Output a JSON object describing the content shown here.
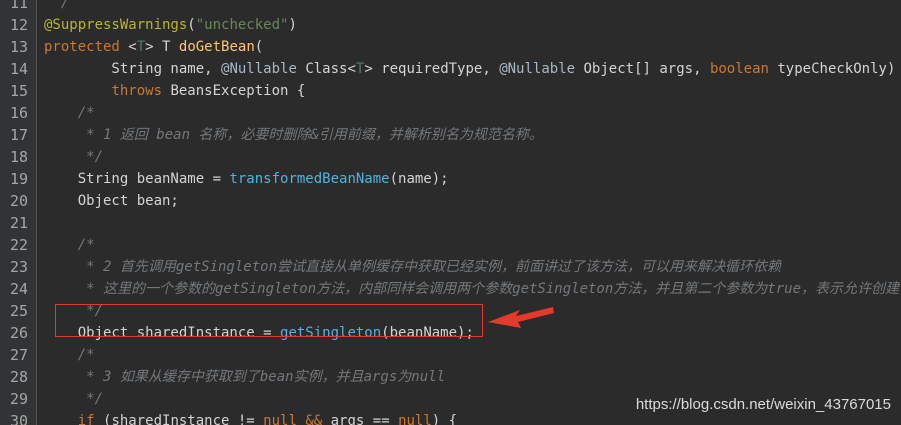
{
  "editor": {
    "lines": [
      {
        "num": "11",
        "tokens": [
          {
            "t": "  /",
            "c": "cm"
          }
        ]
      },
      {
        "num": "12",
        "tokens": [
          {
            "t": "@SuppressWarnings",
            "c": "ann"
          },
          {
            "t": "(",
            "c": "op"
          },
          {
            "t": "\"unchecked\"",
            "c": "str"
          },
          {
            "t": ")",
            "c": "op"
          }
        ]
      },
      {
        "num": "13",
        "tokens": [
          {
            "t": "protected ",
            "c": "kw"
          },
          {
            "t": "<",
            "c": "op"
          },
          {
            "t": "T",
            "c": "gen"
          },
          {
            "t": "> T ",
            "c": "op"
          },
          {
            "t": "doGetBean",
            "c": "fn"
          },
          {
            "t": "(",
            "c": "op"
          }
        ]
      },
      {
        "num": "14",
        "tokens": [
          {
            "t": "        String name, ",
            "c": "ty"
          },
          {
            "t": "@Nullable ",
            "c": "annp"
          },
          {
            "t": "Class",
            "c": "ty"
          },
          {
            "t": "<",
            "c": "op"
          },
          {
            "t": "T",
            "c": "gen"
          },
          {
            "t": "> requiredType, ",
            "c": "ty"
          },
          {
            "t": "@Nullable ",
            "c": "annp"
          },
          {
            "t": "Object[] args, ",
            "c": "ty"
          },
          {
            "t": "boolean ",
            "c": "kw"
          },
          {
            "t": "typeCheckOnly)",
            "c": "ty"
          }
        ]
      },
      {
        "num": "15",
        "tokens": [
          {
            "t": "        ",
            "c": "ty"
          },
          {
            "t": "throws ",
            "c": "kw"
          },
          {
            "t": "BeansException {",
            "c": "ty"
          }
        ]
      },
      {
        "num": "16",
        "tokens": [
          {
            "t": "    /*",
            "c": "cm"
          }
        ]
      },
      {
        "num": "17",
        "tokens": [
          {
            "t": "     * 1 返回 bean 名称，必要时删除&引用前缀，并解析别名为规范名称。",
            "c": "cm"
          }
        ]
      },
      {
        "num": "18",
        "tokens": [
          {
            "t": "     */",
            "c": "cm"
          }
        ]
      },
      {
        "num": "19",
        "tokens": [
          {
            "t": "    String beanName ",
            "c": "ty"
          },
          {
            "t": "= ",
            "c": "op"
          },
          {
            "t": "transformedBeanName",
            "c": "fnc"
          },
          {
            "t": "(name);",
            "c": "ty"
          }
        ]
      },
      {
        "num": "20",
        "tokens": [
          {
            "t": "    Object bean;",
            "c": "ty"
          }
        ]
      },
      {
        "num": "21",
        "tokens": []
      },
      {
        "num": "22",
        "tokens": [
          {
            "t": "    /*",
            "c": "cm"
          }
        ]
      },
      {
        "num": "23",
        "tokens": [
          {
            "t": "     * 2 首先调用getSingleton尝试直接从单例缓存中获取已经实例，前面讲过了该方法，可以用来解决循环依赖",
            "c": "cm"
          }
        ]
      },
      {
        "num": "24",
        "tokens": [
          {
            "t": "     * 这里的一个参数的getSingleton方法，内部同样会调用两个参数getSingleton方法，并且第二个参数为true，表示允许创建",
            "c": "cm"
          }
        ]
      },
      {
        "num": "25",
        "tokens": [
          {
            "t": "     */",
            "c": "cm"
          }
        ]
      },
      {
        "num": "26",
        "tokens": [
          {
            "t": "    Object sharedInstance ",
            "c": "ty"
          },
          {
            "t": "= ",
            "c": "op"
          },
          {
            "t": "getSingleton",
            "c": "fnc"
          },
          {
            "t": "(beanName);",
            "c": "ty"
          }
        ]
      },
      {
        "num": "27",
        "tokens": [
          {
            "t": "    /*",
            "c": "cm"
          }
        ]
      },
      {
        "num": "28",
        "tokens": [
          {
            "t": "     * 3 如果从缓存中获取到了bean实例，并且args为null",
            "c": "cm"
          }
        ]
      },
      {
        "num": "29",
        "tokens": [
          {
            "t": "     */",
            "c": "cm"
          }
        ]
      },
      {
        "num": "30",
        "tokens": [
          {
            "t": "    ",
            "c": "ty"
          },
          {
            "t": "if ",
            "c": "kw"
          },
          {
            "t": "(sharedInstance ",
            "c": "ty"
          },
          {
            "t": "!= ",
            "c": "op"
          },
          {
            "t": "null ",
            "c": "kw"
          },
          {
            "t": "&& ",
            "c": "kw"
          },
          {
            "t": "args ",
            "c": "ty"
          },
          {
            "t": "== ",
            "c": "op"
          },
          {
            "t": "null",
            "c": "kw"
          },
          {
            "t": ") {",
            "c": "ty"
          }
        ]
      }
    ]
  },
  "watermark": "https://blog.csdn.net/weixin_43767015",
  "colors": {
    "background": "#2b2b2b",
    "gutter": "#313335",
    "highlight": "#e23a2b",
    "arrow": "#e23a2b"
  }
}
